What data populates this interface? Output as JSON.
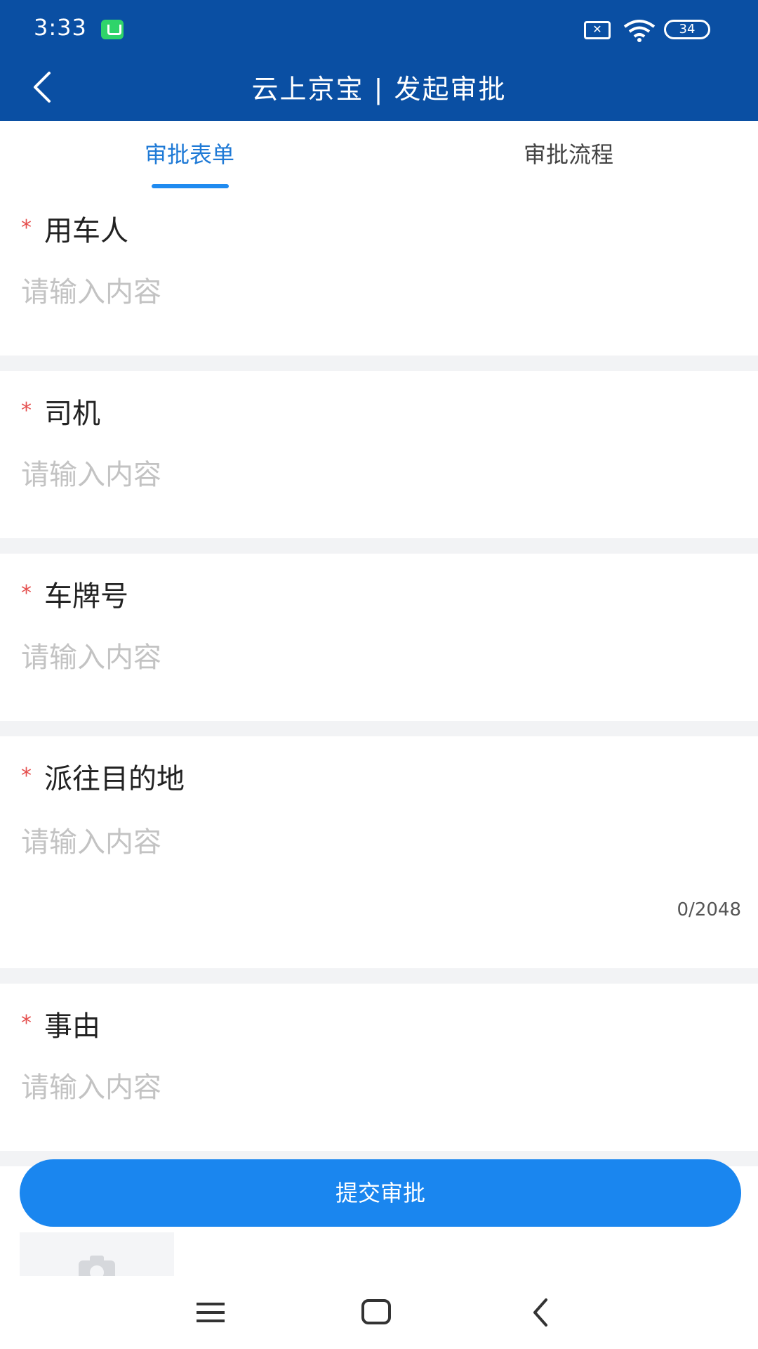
{
  "status_bar": {
    "time": "3:33",
    "battery": "34"
  },
  "header": {
    "title": "云上京宝 | 发起审批"
  },
  "tabs": [
    {
      "label": "审批表单"
    },
    {
      "label": "审批流程"
    }
  ],
  "form": {
    "fields": [
      {
        "label": "用车人",
        "placeholder": "请输入内容",
        "value": ""
      },
      {
        "label": "司机",
        "placeholder": "请输入内容",
        "value": ""
      },
      {
        "label": "车牌号",
        "placeholder": "请输入内容",
        "value": ""
      },
      {
        "label": "派往目的地",
        "placeholder": "请输入内容",
        "value": "",
        "counter": "0/2048"
      },
      {
        "label": "事由",
        "placeholder": "请输入内容",
        "value": ""
      }
    ],
    "required_mark": "*"
  },
  "submit": {
    "label": "提交审批"
  },
  "colors": {
    "header_bg": "#0a4fa3",
    "accent": "#1a86ef",
    "required": "#e5504f"
  },
  "icons": [
    "back-icon",
    "wifi-icon",
    "sim-icon",
    "battery-icon",
    "camera-icon",
    "menu-icon",
    "home-icon",
    "nav-back-icon"
  ]
}
